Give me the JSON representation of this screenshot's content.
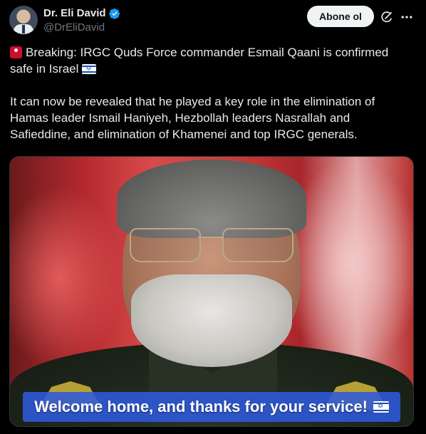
{
  "author": {
    "display_name": "Dr. Eli David",
    "handle": "@DrEliDavid",
    "verified": true
  },
  "actions": {
    "follow_label": "Abone ol"
  },
  "icons": {
    "verified": "verified-badge-icon",
    "grok": "grok-icon",
    "more": "more-options-icon"
  },
  "post": {
    "line1": "Breaking: IRGC Quds Force commander Esmail Qaani is confirmed safe in Israel",
    "line2": "It can now be revealed that he played a key role in the elimination of Hamas leader Ismail Haniyeh, Hezbollah leaders Nasrallah and Safieddine, and elimination of Khamenei and top IRGC generals."
  },
  "media": {
    "caption": "Welcome home, and thanks for your service!"
  },
  "colors": {
    "background": "#000000",
    "text": "#e7e9ea",
    "secondary_text": "#71767b",
    "verified_blue": "#1d9bf0",
    "caption_bar": "#2d5adc"
  }
}
